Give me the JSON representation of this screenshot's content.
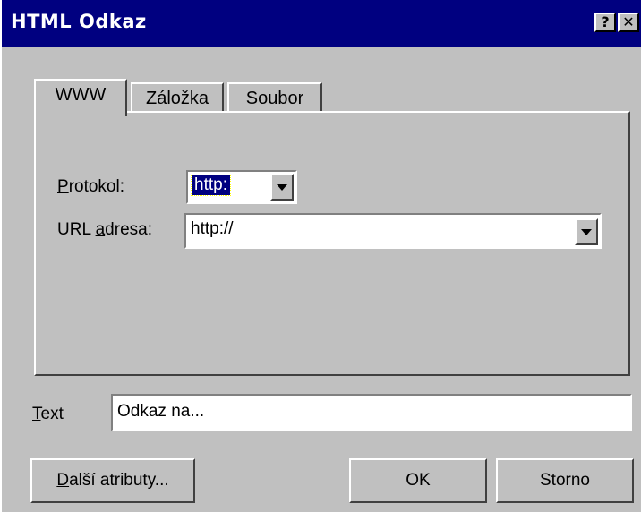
{
  "window": {
    "title": "HTML Odkaz"
  },
  "titlebar": {
    "help_glyph": "?",
    "close_glyph": "✕"
  },
  "tabs": [
    {
      "label": "WWW",
      "active": true
    },
    {
      "label": "Záložka",
      "active": false
    },
    {
      "label": "Soubor",
      "active": false
    }
  ],
  "www": {
    "protocol_label_hotkey": "P",
    "protocol_label_rest": "rotokol:",
    "protocol_value": "http:",
    "url_label_pre": "URL ",
    "url_label_hotkey": "a",
    "url_label_rest": "dresa:",
    "url_value": "http://"
  },
  "text_field": {
    "label_hotkey": "T",
    "label_rest": "ext",
    "value": "Odkaz na..."
  },
  "buttons": {
    "more_hotkey": "D",
    "more_rest": "alší atributy...",
    "ok": "OK",
    "cancel": "Storno"
  },
  "colors": {
    "titlebar": "#000080",
    "face": "#c0c0c0",
    "selection": "#000080"
  }
}
